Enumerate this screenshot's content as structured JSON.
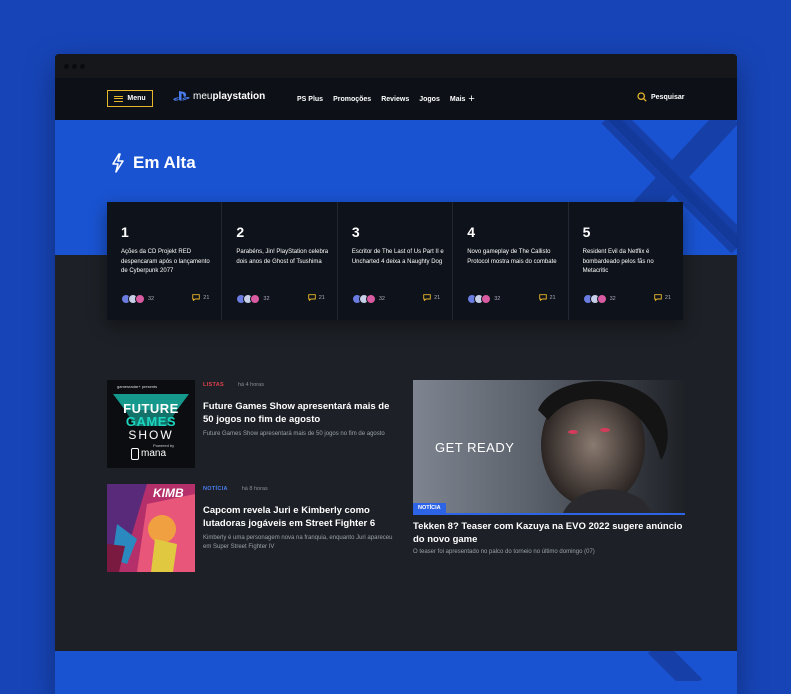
{
  "nav": {
    "menu_label": "Menu",
    "logo_light": "meu",
    "logo_bold": "playstation",
    "links": [
      "PS Plus",
      "Promoções",
      "Reviews",
      "Jogos",
      "Mais"
    ],
    "search_label": "Pesquisar"
  },
  "hero": {
    "title": "Em Alta"
  },
  "trending": [
    {
      "rank": "1",
      "title": "Ações da CD Projekt RED despencaram após o lançamento de Cyberpunk 2077",
      "likes": "32",
      "comments": "21"
    },
    {
      "rank": "2",
      "title": "Parabéns, Jin! PlayStation celebra dois anos de Ghost of Tsushima",
      "likes": "32",
      "comments": "21"
    },
    {
      "rank": "3",
      "title": "Escritor de The Last of Us Part II e Uncharted 4 deixa a Naughty Dog",
      "likes": "32",
      "comments": "21"
    },
    {
      "rank": "4",
      "title": "Novo gameplay de The Callisto Protocol mostra mais do combate",
      "likes": "32",
      "comments": "21"
    },
    {
      "rank": "5",
      "title": "Resident Evil da Netflix é bombardeado pelos fãs no Metacritic",
      "likes": "32",
      "comments": "21"
    }
  ],
  "articles": [
    {
      "tag": "LISTAS",
      "time": "há 4 horas",
      "title": "Future Games Show apresentará mais de 50 jogos no fim de agosto",
      "desc": "Future Games Show apresentará mais de 50 jogos no fim de agosto",
      "thumb_top": "gamesradar+ presents",
      "thumb_line1": "FUTURE",
      "thumb_line2": "GAMES",
      "thumb_line3": "SHOW",
      "thumb_sub": "Powered by",
      "thumb_brand": "mana"
    },
    {
      "tag": "NOTÍCIA",
      "time": "há 8 horas",
      "title": "Capcom revela Juri e Kimberly como lutadoras jogáveis em Street Fighter 6",
      "desc": "Kimberly é uma personagem nova na franquia, enquanto Juri apareceu em Super Street Fighter IV",
      "thumb_text": "KIMB"
    }
  ],
  "featured": {
    "tag": "NOTÍCIA",
    "overlay": "GET READY",
    "title": "Tekken 8? Teaser com Kazuya na EVO 2022 sugere anúncio do novo game",
    "desc": "O teaser foi apresentado no palco do torneio no último domingo (07)"
  },
  "colors": {
    "page_bg": "#1745b8",
    "window_bg": "#1d2026",
    "hero_bg": "#1a53d1",
    "accent_yellow": "#e8b62b",
    "tag_red": "#e0414b",
    "tag_blue": "#4a7df0"
  },
  "icons": [
    "hamburger-icon",
    "playstation-logo-icon",
    "plus-icon",
    "search-icon",
    "lightning-icon",
    "comment-icon",
    "avatar-icon"
  ]
}
